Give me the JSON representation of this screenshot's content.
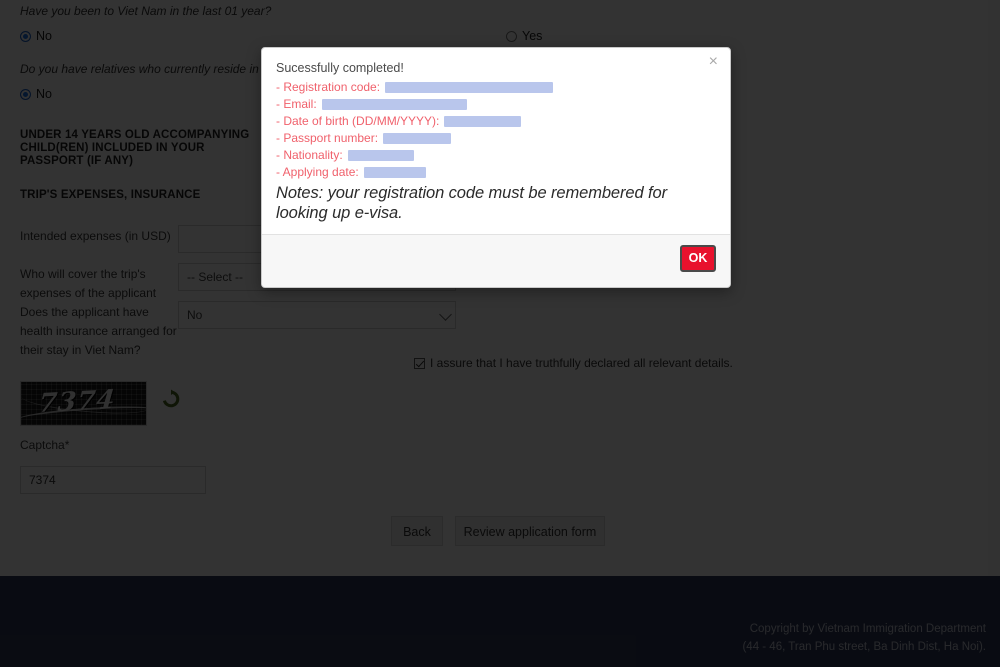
{
  "form": {
    "questions": [
      {
        "text": "Have you been to Viet Nam in the last 01 year?"
      },
      {
        "text": "Do you have relatives who currently reside in Viet Nam?"
      }
    ],
    "radios": {
      "q1_no": "No",
      "q1_yes": "Yes",
      "q2_no": "No"
    },
    "section_headings": [
      "UNDER 14 YEARS OLD ACCOMPANYING CHILD(REN) INCLUDED IN YOUR PASSPORT (IF ANY)",
      "TRIP'S EXPENSES, INSURANCE"
    ],
    "fields": {
      "expenses_label": "Intended expenses (in USD)",
      "expenses_value": "",
      "cover_label": "Who will cover the trip's expenses of the applicant",
      "cover_value": "-- Select --",
      "health_label": "Does the applicant have health insurance arranged for their stay in Viet Nam?",
      "health_value": "No"
    },
    "assurance_label": "I assure that I have truthfully declared all relevant details.",
    "captcha": {
      "image_text": "7374",
      "label": "Captcha*",
      "input_value": "7374",
      "refresh_icon": "refresh-icon"
    },
    "buttons": {
      "back": "Back",
      "review": "Review application form"
    }
  },
  "modal": {
    "close_icon": "close-icon",
    "close_label": "×",
    "title": "Sucessfully completed!",
    "info_lines": [
      {
        "label": "- Registration code:",
        "redacted_width": 168
      },
      {
        "label": "- Email:",
        "redacted_width": 145
      },
      {
        "label": "- Date of birth (DD/MM/YYYY):",
        "redacted_width": 77
      },
      {
        "label": "- Passport number:",
        "redacted_width": 68
      },
      {
        "label": "- Nationality:",
        "redacted_width": 66
      },
      {
        "label": "- Applying date:",
        "redacted_width": 62
      }
    ],
    "notes": "Notes: your registration code must be remembered for looking up e-visa.",
    "ok_label": "OK"
  },
  "footer": {
    "line1": "Copyright by Vietnam Immigration Department",
    "line2": "(44 - 46, Tran Phu street, Ba Dinh Dist, Ha Noi)."
  },
  "colors": {
    "accent_red": "#e8112d",
    "info_text": "#f0616c",
    "redaction": "#b9c6ec",
    "footer_bg": "#303b5c",
    "radio_blue": "#1a73e8"
  }
}
